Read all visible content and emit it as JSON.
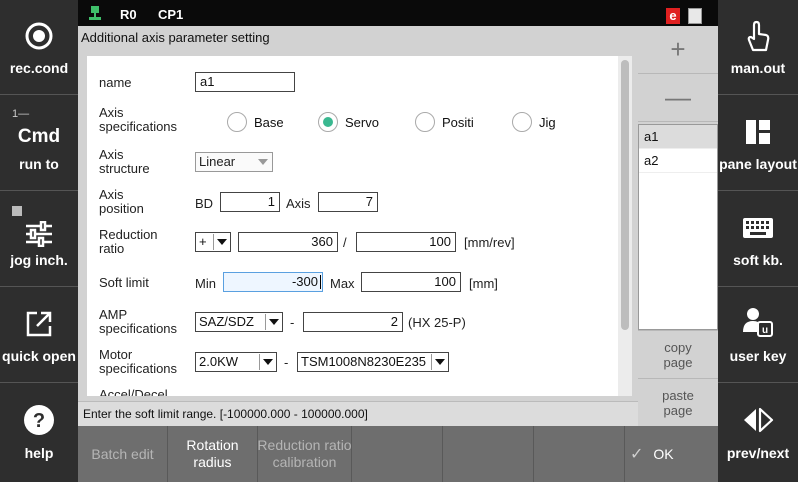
{
  "status_bar": {
    "robot_label": "R0",
    "program_label": "CP1",
    "badge": "e"
  },
  "left_sidebar": [
    {
      "label": "rec.cond",
      "icon": "record-circle-icon"
    },
    {
      "label": "run to",
      "icon": "cmd-icon",
      "cmd": "Cmd",
      "prefix": "1—"
    },
    {
      "label": "jog inch.",
      "icon": "sliders-icon"
    },
    {
      "label": "quick open",
      "icon": "open-external-icon"
    },
    {
      "label": "help",
      "icon": "help-icon"
    }
  ],
  "right_sidebar": [
    {
      "label": "man.out",
      "icon": "hand-pointer-icon"
    },
    {
      "label": "pane layout",
      "icon": "pane-layout-icon"
    },
    {
      "label": "soft kb.",
      "icon": "keyboard-icon"
    },
    {
      "label": "user key",
      "icon": "user-key-icon"
    },
    {
      "label": "prev/next",
      "icon": "prev-next-icon"
    }
  ],
  "dialog": {
    "title": "Additional axis parameter setting",
    "status_message": "Enter the soft limit range. [-100000.000 - 100000.000]",
    "fields": {
      "name": {
        "label": "name",
        "value": "a1"
      },
      "axis_spec": {
        "label_l1": "Axis",
        "label_l2": "specifications",
        "options": [
          "Base",
          "Servo",
          "Positi",
          "Jig"
        ],
        "selected": "Servo"
      },
      "axis_structure": {
        "label_l1": "Axis",
        "label_l2": "structure",
        "value": "Linear"
      },
      "axis_position": {
        "label_l1": "Axis",
        "label_l2": "position",
        "bd_label": "BD",
        "bd_value": "1",
        "axis_label": "Axis",
        "axis_value": "7"
      },
      "reduction_ratio": {
        "label_l1": "Reduction",
        "label_l2": "ratio",
        "sign": "+",
        "numerator": "360",
        "separator": "/",
        "denominator": "100",
        "unit": "[mm/rev]"
      },
      "soft_limit": {
        "label": "Soft limit",
        "min_label": "Min",
        "min_value": "-300",
        "max_label": "Max",
        "max_value": "100",
        "unit": "[mm]"
      },
      "amp_spec": {
        "label_l1": "AMP",
        "label_l2": "specifications",
        "value": "SAZ/SDZ",
        "dash": "-",
        "number": "2",
        "note": "(HX 25-P)"
      },
      "motor_spec": {
        "label_l1": "Motor",
        "label_l2": "specifications",
        "power": "2.0KW",
        "dash": "-",
        "model": "TSM1008N8230E235"
      },
      "next_partial": {
        "label": "Accel/Decel"
      }
    }
  },
  "right_pane": {
    "add_symbol": "+",
    "remove_symbol": "—",
    "items": [
      "a1",
      "a2"
    ],
    "selected": "a1",
    "copy_label_l1": "copy",
    "copy_label_l2": "page",
    "paste_label_l1": "paste",
    "paste_label_l2": "page"
  },
  "bottom_bar": {
    "batch_edit": "Batch edit",
    "rotation_l1": "Rotation",
    "rotation_l2": "radius",
    "reduction_l1": "Reduction ratio",
    "reduction_l2": "calibration",
    "ok": "OK"
  }
}
